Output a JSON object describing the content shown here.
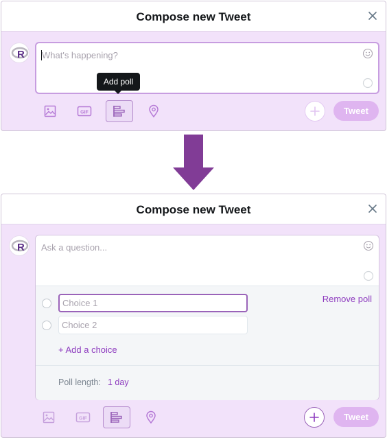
{
  "dialog_before": {
    "title": "Compose new Tweet",
    "compose_placeholder": "What's happening?",
    "tooltip": "Add poll",
    "tweet_label": "Tweet"
  },
  "dialog_after": {
    "title": "Compose new Tweet",
    "compose_placeholder": "Ask a question...",
    "poll": {
      "choices": [
        {
          "placeholder": "Choice 1"
        },
        {
          "placeholder": "Choice 2"
        }
      ],
      "add_choice": "+ Add a choice",
      "remove_poll": "Remove poll",
      "length_label": "Poll length:",
      "length_value": "1 day"
    },
    "tweet_label": "Tweet"
  },
  "toolbar_icons": [
    "image-icon",
    "gif-icon",
    "poll-icon",
    "location-icon"
  ],
  "icons": {
    "close": "close-icon",
    "emoji": "emoji-icon",
    "plus": "plus-icon"
  },
  "colors": {
    "dialog_bg": "#f2e2fa",
    "accent": "#8e3cbf",
    "tweet_button_disabled": "#dfb5f0",
    "arrow": "#813c96",
    "tooltip_bg": "#14171a"
  }
}
